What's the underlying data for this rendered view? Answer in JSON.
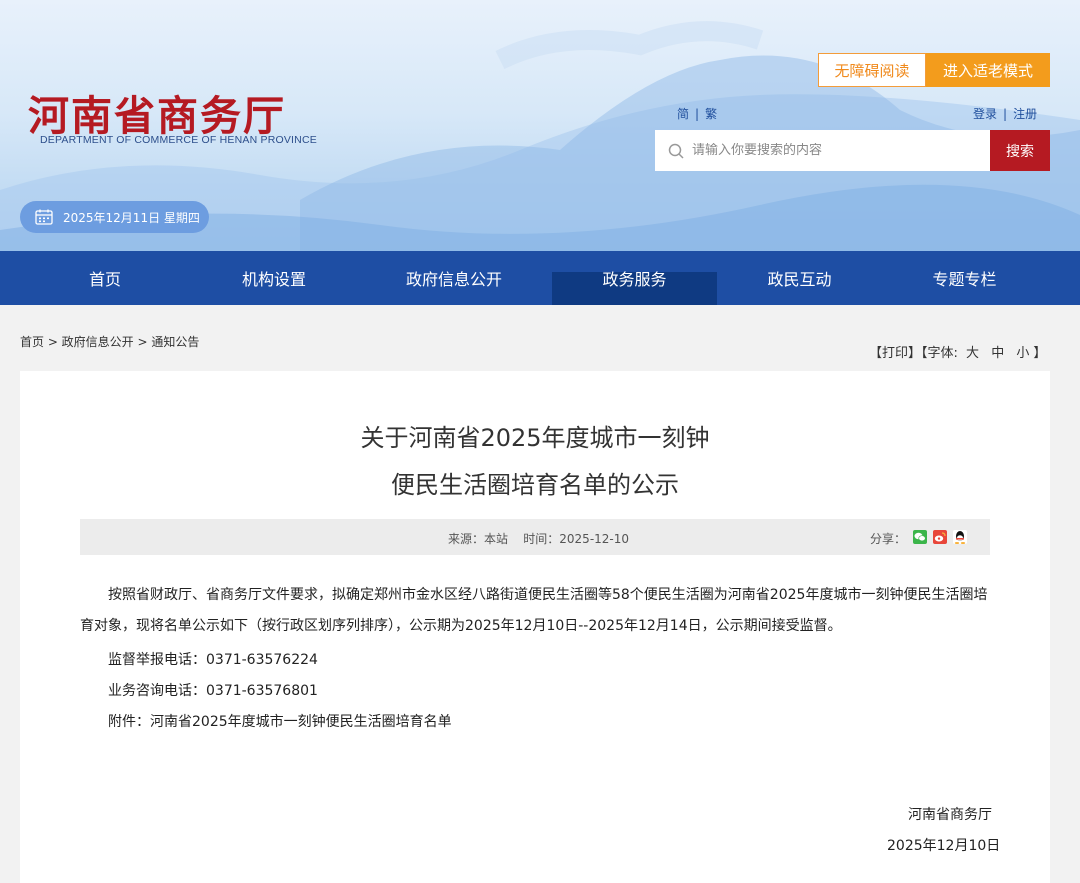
{
  "header": {
    "logo_title": "河南省商务厅",
    "logo_subtitle": "DEPARTMENT OF COMMERCE OF HENAN PROVINCE",
    "accessibility_label": "无障碍阅读",
    "elder_mode_label": "进入适老模式",
    "lang_simplified": "简",
    "lang_traditional": "繁",
    "login_label": "登录",
    "register_label": "注册",
    "search_placeholder": "请输入你要搜索的内容",
    "search_button": "搜索",
    "date_text": "2025年12月11日 星期四"
  },
  "nav": {
    "items": [
      {
        "label": "首页"
      },
      {
        "label": "机构设置"
      },
      {
        "label": "政府信息公开"
      },
      {
        "label": "政务服务"
      },
      {
        "label": "政民互动"
      },
      {
        "label": "专题专栏"
      }
    ]
  },
  "breadcrumb": "首页 > 政府信息公开 > 通知公告",
  "tools": {
    "print": "【打印】",
    "font_label": "【字体:",
    "big": "大",
    "mid": "中",
    "small": "小",
    "close": "】"
  },
  "article": {
    "title_line1": "关于河南省2025年度城市一刻钟",
    "title_line2": "便民生活圈培育名单的公示",
    "source": "来源：本站",
    "time": "时间：2025-12-10",
    "share": "分享：",
    "paragraph": "按照省财政厅、省商务厅文件要求，拟确定郑州市金水区经八路街道便民生活圈等58个便民生活圈为河南省2025年度城市一刻钟便民生活圈培育对象，现将名单公示如下（按行政区划序列排序），公示期为2025年12月10日--2025年12月14日，公示期间接受监督。",
    "supervise_phone": "监督举报电话：0371-63576224",
    "consult_phone": "业务咨询电话：0371-63576801",
    "attachment": "附件：河南省2025年度城市一刻钟便民生活圈培育名单",
    "sign_org": "河南省商务厅",
    "sign_date": "2025年12月10日"
  },
  "colors": {
    "brand_red": "#b51a22",
    "nav_blue": "#1e4ea4",
    "accent_orange": "#f39c1c"
  }
}
